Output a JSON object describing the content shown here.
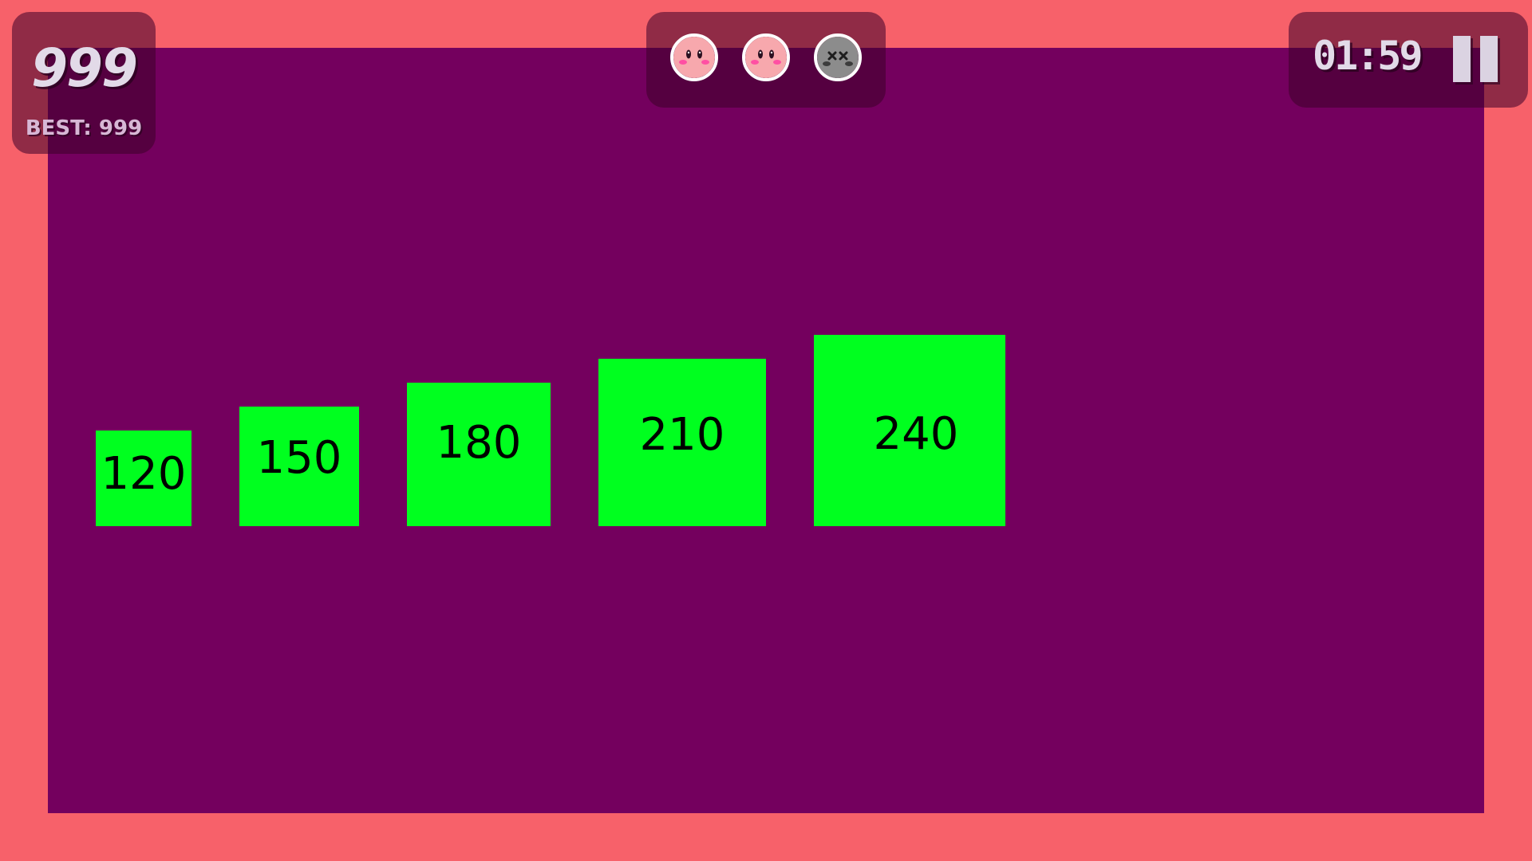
{
  "hud": {
    "score": "999",
    "best_label": "BEST:",
    "best_value": "999",
    "timer": "01:59"
  },
  "lives": [
    {
      "state": "alive",
      "icon": "pink-face-icon"
    },
    {
      "state": "alive",
      "icon": "pink-face-icon"
    },
    {
      "state": "lost",
      "icon": "gray-dead-face-icon"
    }
  ],
  "blocks": [
    {
      "label": "120"
    },
    {
      "label": "150"
    },
    {
      "label": "180"
    },
    {
      "label": "210"
    },
    {
      "label": "240"
    }
  ],
  "colors": {
    "border_background": "#f7616a",
    "playfield": "#74005e",
    "block": "#00ff1f",
    "hud_text": "#e2dae8",
    "life_alive": "#f7a8ad",
    "life_lost": "#8c8c8c"
  }
}
